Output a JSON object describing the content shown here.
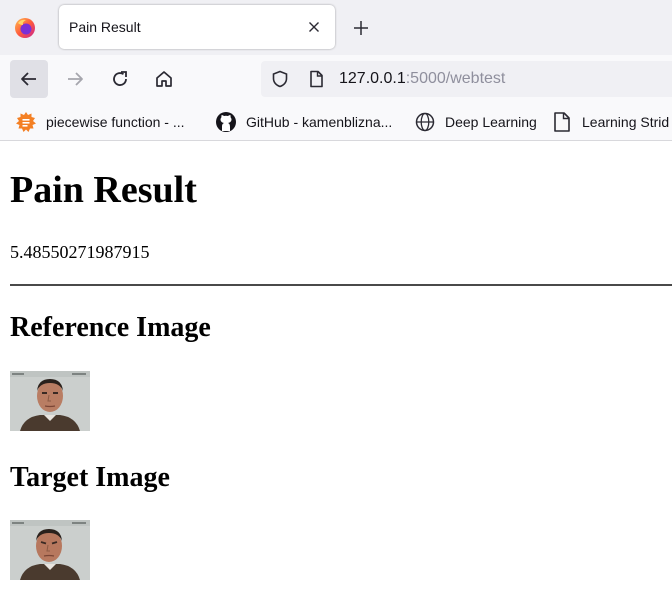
{
  "browser": {
    "tab": {
      "title": "Pain Result",
      "close_icon": "close-icon"
    },
    "url": {
      "host": "127.0.0.1",
      "rest": ":5000/webtest"
    },
    "bookmarks": [
      {
        "label": "piecewise function - ...",
        "icon": "bookmark-favicon"
      },
      {
        "label": "GitHub - kamenbliznа...",
        "icon": "github-icon"
      },
      {
        "label": "Deep Learning",
        "icon": "globe-icon"
      },
      {
        "label": "Learning Strid",
        "icon": "page-icon"
      }
    ]
  },
  "page": {
    "title": "Pain Result",
    "score": "5.48550271987915",
    "reference_heading": "Reference Image",
    "target_heading": "Target Image"
  },
  "colors": {
    "tabbar_bg": "#f0f0f4",
    "toolbar_bg": "#f9f9fb",
    "url_muted": "#8f8f9d"
  }
}
